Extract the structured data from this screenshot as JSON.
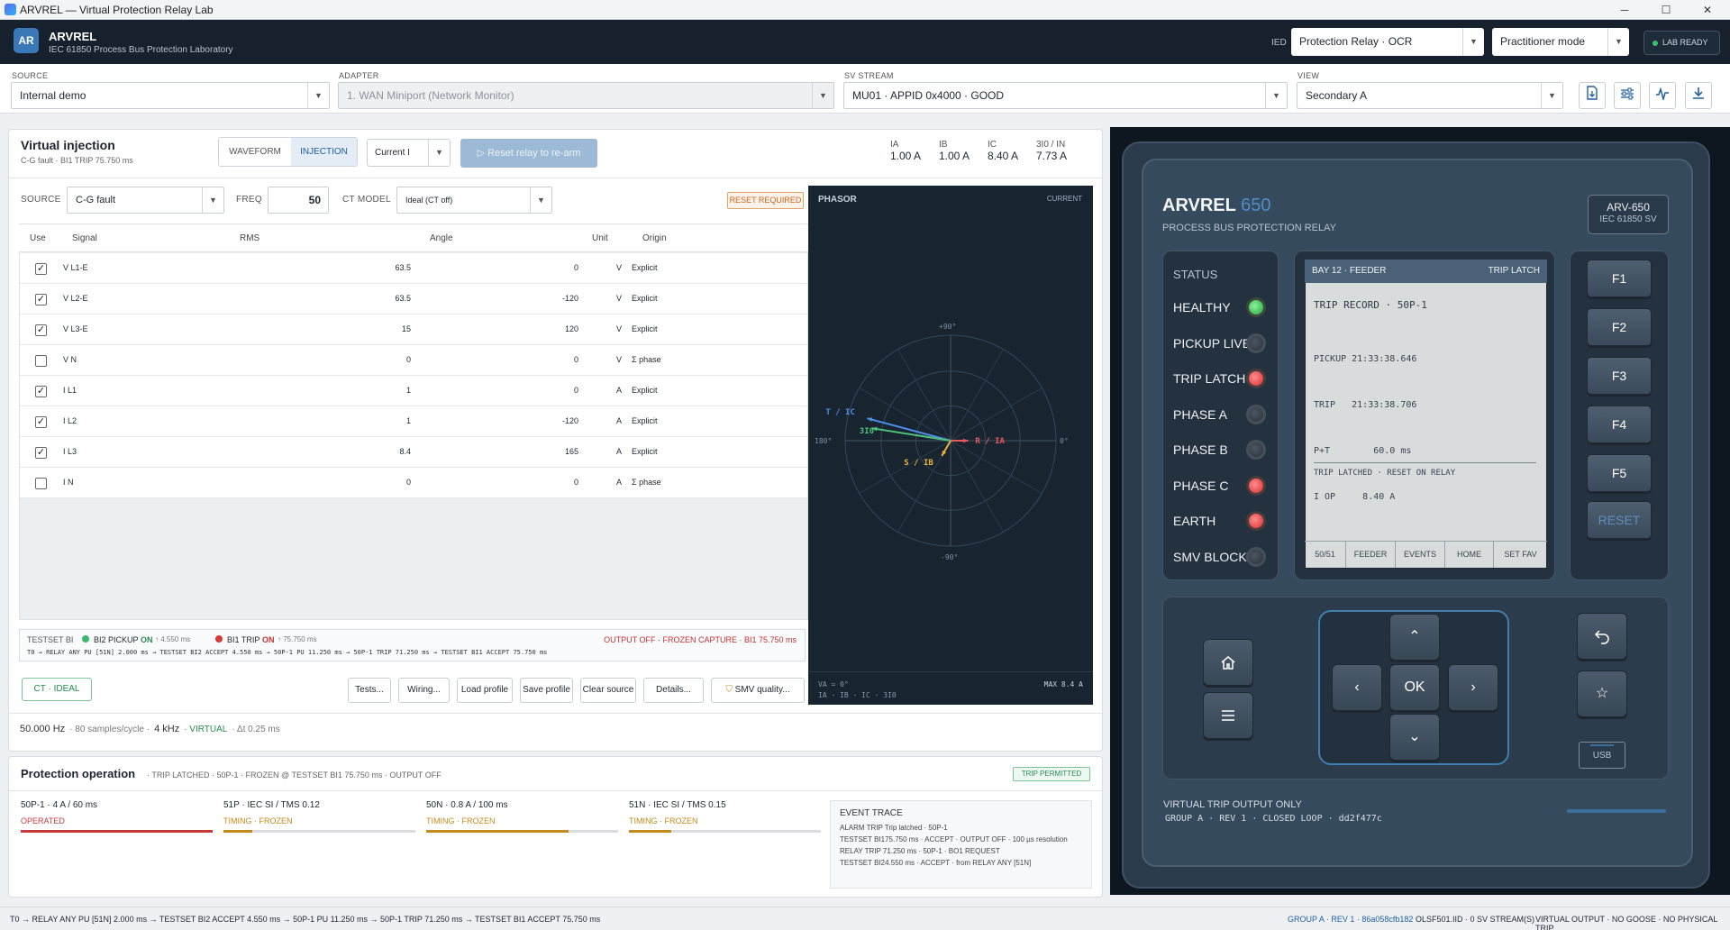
{
  "window": {
    "title": "ARVREL — Virtual Protection Relay Lab",
    "minimize": "─",
    "maximize": "☐",
    "close": "✕"
  },
  "header": {
    "logo": "AR",
    "app_name": "ARVREL",
    "app_subtitle": "IEC 61850 Process Bus Protection Laboratory",
    "ied_label": "IED",
    "ied_value": "Protection Relay · OCR",
    "mode_value": "Practitioner mode",
    "status": "LAB READY"
  },
  "toolbar": {
    "source": {
      "label": "SOURCE",
      "value": "Internal demo"
    },
    "adapter": {
      "label": "ADAPTER",
      "value": "1. WAN Miniport (Network Monitor)"
    },
    "sv_stream": {
      "label": "SV STREAM",
      "value": "MU01 · APPID 0x4000 · GOOD"
    },
    "view": {
      "label": "VIEW",
      "value": "Secondary A"
    }
  },
  "injection": {
    "title": "Virtual injection",
    "subtitle": "C-G fault · BI1 TRIP 75.750 ms",
    "tabs": [
      "WAVEFORM",
      "INJECTION"
    ],
    "active_tab": "INJECTION",
    "quantity_select": "Current I",
    "reset_button": "Reset relay to re-arm",
    "measurements": [
      {
        "label": "IA",
        "value": "1.00 A"
      },
      {
        "label": "IB",
        "value": "1.00 A"
      },
      {
        "label": "IC",
        "value": "8.40 A"
      },
      {
        "label": "3I0 / IN",
        "value": "7.73 A"
      }
    ],
    "source_label": "SOURCE",
    "source_value": "C-G fault",
    "freq_label": "FREQ",
    "freq_value": "50",
    "ct_model_label": "CT MODEL",
    "ct_model_value": "Ideal (CT off)",
    "reset_required": "RESET REQUIRED",
    "columns": [
      "Use",
      "Signal",
      "RMS",
      "Angle",
      "Unit",
      "Origin"
    ],
    "rows": [
      {
        "use": true,
        "signal": "V L1-E",
        "rms": "63.5",
        "angle": "0",
        "unit": "V",
        "origin": "Explicit"
      },
      {
        "use": true,
        "signal": "V L2-E",
        "rms": "63.5",
        "angle": "-120",
        "unit": "V",
        "origin": "Explicit"
      },
      {
        "use": true,
        "signal": "V L3-E",
        "rms": "15",
        "angle": "120",
        "unit": "V",
        "origin": "Explicit"
      },
      {
        "use": false,
        "signal": "V N",
        "rms": "0",
        "angle": "0",
        "unit": "V",
        "origin": "Σ phase"
      },
      {
        "use": true,
        "signal": "I L1",
        "rms": "1",
        "angle": "0",
        "unit": "A",
        "origin": "Explicit"
      },
      {
        "use": true,
        "signal": "I L2",
        "rms": "1",
        "angle": "-120",
        "unit": "A",
        "origin": "Explicit"
      },
      {
        "use": true,
        "signal": "I L3",
        "rms": "8.4",
        "angle": "165",
        "unit": "A",
        "origin": "Explicit"
      },
      {
        "use": false,
        "signal": "I N",
        "rms": "0",
        "angle": "0",
        "unit": "A",
        "origin": "Σ phase"
      }
    ],
    "testset": {
      "label": "TESTSET BI",
      "bi2": "BI2 PICKUP",
      "bi2_state": "ON",
      "bi2_time": "↑ 4.550 ms",
      "bi1": "BI1 TRIP",
      "bi1_state": "ON",
      "bi1_time": "↑ 75.750 ms",
      "output": "OUTPUT OFF · FROZEN CAPTURE · BI1 75.750 ms",
      "sequence": "T0 → RELAY ANY PU [51N] 2.000 ms → TESTSET BI2 ACCEPT 4.550 ms → 50P-1 PU 11.250 ms → 50P-1 TRIP 71.250 ms → TESTSET BI1 ACCEPT 75.750 ms"
    },
    "ct_badge": "CT · IDEAL",
    "buttons": [
      "Tests...",
      "Wiring...",
      "Load profile",
      "Save profile",
      "Clear source",
      "Details...",
      "SMV quality..."
    ],
    "footer": {
      "freq": "50.000 Hz",
      "samples": "· 80 samples/cycle ·",
      "rate": "4 kHz",
      "virtual": "· VIRTUAL",
      "dt": "· Δt 0.25 ms"
    }
  },
  "phasor": {
    "title": "PHASOR",
    "mode": "CURRENT",
    "label_top": "+90°",
    "label_bottom": "-90°",
    "label_left": "180°",
    "label_right": "0°",
    "ref": "VA = 0°",
    "legend": "IA · IB · IC · 3I0",
    "max": "MAX 8.4 A",
    "vectors": [
      {
        "label": "R / IA",
        "magnitude": 1.0,
        "angle": 0,
        "color": "#e85a5a"
      },
      {
        "label": "S / IB",
        "magnitude": 1.0,
        "angle": -120,
        "color": "#e8b23a"
      },
      {
        "label": "T / IC",
        "magnitude": 8.4,
        "angle": 165,
        "color": "#4f8ee8"
      },
      {
        "label": "3I0",
        "magnitude": 7.73,
        "angle": 171,
        "color": "#4ec27a"
      }
    ]
  },
  "protection": {
    "title": "Protection operation",
    "summary": "· TRIP LATCHED · 50P-1 · FROZEN @ TESTSET BI1 75.750 ms · OUTPUT OFF",
    "badge": "TRIP PERMITTED",
    "elements": [
      {
        "name": "50P-1 · 4 A / 60 ms",
        "state": "OPERATED",
        "progress": 1.0
      },
      {
        "name": "51P · IEC SI / TMS 0.12",
        "state": "TIMING · FROZEN",
        "progress": 0.15
      },
      {
        "name": "50N · 0.8 A / 100 ms",
        "state": "TIMING · FROZEN",
        "progress": 0.74
      },
      {
        "name": "51N · IEC SI / TMS 0.15",
        "state": "TIMING · FROZEN",
        "progress": 0.22
      }
    ],
    "event_trace_title": "EVENT TRACE",
    "events": [
      "ALARM TRIP Trip latched · 50P-1",
      "TESTSET BI175.750 ms · ACCEPT · OUTPUT OFF · 100 µs resolution",
      "RELAY TRIP 71.250 ms · 50P-1 · BO1 REQUEST",
      "TESTSET BI24.550 ms · ACCEPT · from RELAY ANY [51N]"
    ]
  },
  "statusbar": {
    "sequence": "T0 → RELAY ANY PU [51N] 2.000 ms → TESTSET BI2 ACCEPT 4.550 ms → 50P-1 PU 11.250 ms → 50P-1 TRIP 71.250 ms → TESTSET BI1 ACCEPT 75.750 ms",
    "group": "GROUP A · REV 1 · 86a058cfb182",
    "ied": "OLSF501.IID · 0 SV STREAM(S)",
    "output": "VIRTUAL OUTPUT · NO GOOSE · NO PHYSICAL TRIP"
  },
  "relay": {
    "brand": "ARVREL",
    "model_num": "650",
    "subtitle": "PROCESS BUS PROTECTION RELAY",
    "badge_model": "ARV-650",
    "badge_std": "IEC 61850 SV",
    "status_title": "STATUS",
    "leds": [
      {
        "label": "HEALTHY",
        "state": "green"
      },
      {
        "label": "PICKUP LIVE",
        "state": "off"
      },
      {
        "label": "TRIP LATCH",
        "state": "red"
      },
      {
        "label": "PHASE A",
        "state": "off"
      },
      {
        "label": "PHASE B",
        "state": "off"
      },
      {
        "label": "PHASE C",
        "state": "red"
      },
      {
        "label": "EARTH",
        "state": "red"
      },
      {
        "label": "SMV BLOCK",
        "state": "off"
      }
    ],
    "lcd": {
      "header_left": "BAY 12 · FEEDER",
      "header_right": "TRIP LATCH",
      "record": "TRIP RECORD · 50P-1",
      "lines": [
        "PICKUP 21:33:38.646",
        "TRIP   21:33:38.706",
        "P+T        60.0 ms",
        "I OP     8.40 A"
      ],
      "footer": "TRIP LATCHED · RESET ON RELAY",
      "softkeys": [
        "50/51",
        "FEEDER",
        "EVENTS",
        "HOME",
        "SET FAV"
      ]
    },
    "fkeys": [
      "F1",
      "F2",
      "F3",
      "F4",
      "F5"
    ],
    "reset_key": "RESET",
    "ok_key": "OK",
    "usb": "USB",
    "footer_title": "VIRTUAL TRIP OUTPUT ONLY",
    "footer_sub": "GROUP A · REV 1 · CLOSED LOOP · dd2f477c"
  }
}
